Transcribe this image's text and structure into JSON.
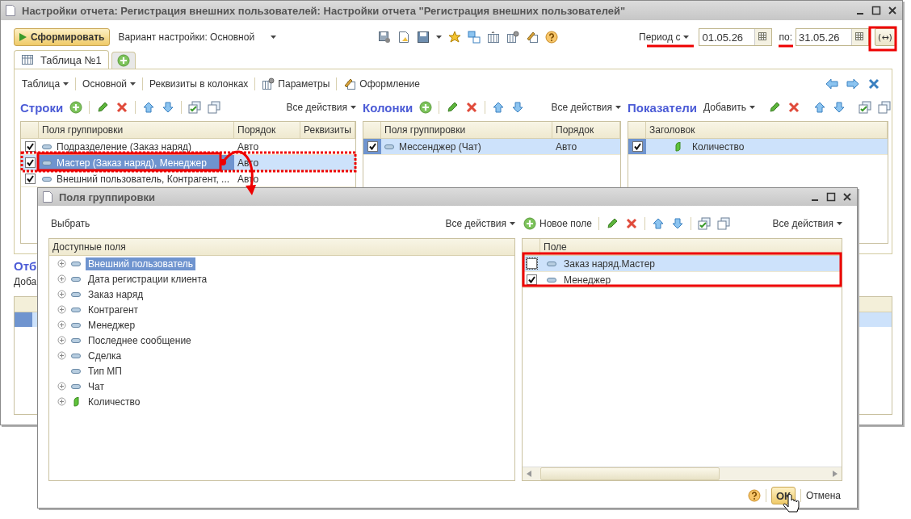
{
  "window": {
    "title": "Настройки отчета: Регистрация внешних пользователей: Настройки отчета \"Регистрация внешних пользователей\""
  },
  "toolbar": {
    "generate": "Сформировать",
    "variant": "Вариант настройки: Основной",
    "period_label": "Период с",
    "date_from": "01.05.26",
    "to_label": "по:",
    "date_to": "31.05.26",
    "period_button": "(↔)"
  },
  "tabs": [
    {
      "label": "Таблица №1",
      "selected": true
    }
  ],
  "settings_menu": [
    {
      "label": "Таблица",
      "kind": "menu"
    },
    {
      "label": "Основной",
      "kind": "menu"
    },
    {
      "label": "Реквизиты в колонках",
      "kind": "plain"
    },
    {
      "label": "Параметры",
      "kind": "params"
    },
    {
      "label": "Оформление",
      "kind": "design"
    }
  ],
  "rows_panel": {
    "title": "Строки",
    "all_actions": "Все действия",
    "columns": [
      "Поля группировки",
      "Порядок",
      "Реквизиты"
    ],
    "rows": [
      {
        "checked": true,
        "selected": false,
        "check_focused": false,
        "field_focused": false,
        "field": "Подразделение (Заказ наряд)",
        "order": "Авто"
      },
      {
        "checked": true,
        "selected": true,
        "check_focused": false,
        "field_focused": true,
        "field": "Мастер (Заказ наряд), Менеджер",
        "order": "Авто"
      },
      {
        "checked": true,
        "selected": false,
        "check_focused": false,
        "field_focused": false,
        "field": "Внешний пользователь, Контрагент, ...",
        "order": "Авто"
      }
    ]
  },
  "columns_panel": {
    "title": "Колонки",
    "all_actions": "Все действия",
    "columns": [
      "Поля группировки",
      "Порядок"
    ],
    "rows": [
      {
        "checked": true,
        "selected": true,
        "check_focused": true,
        "field_focused": false,
        "field": "Мессенджер (Чат)",
        "order": "Авто"
      }
    ]
  },
  "indicators_panel": {
    "title": "Показатели",
    "add": "Добавить",
    "columns": [
      "Заголовок"
    ],
    "rows": [
      {
        "checked": true,
        "selected": true,
        "check_focused": true,
        "field_focused": false,
        "field": "Количество"
      }
    ]
  },
  "filters_section": {
    "title": "Отб",
    "add": "Доба"
  },
  "dialog": {
    "title": "Поля группировки",
    "select": "Выбрать",
    "all_actions_left": "Все действия",
    "new_field": "Новое поле",
    "all_actions_right": "Все действия",
    "available": {
      "header": "Доступные поля",
      "items": [
        {
          "label": "Внешний пользователь",
          "kind": "field",
          "expandable": true,
          "selected": true
        },
        {
          "label": "Дата регистрации клиента",
          "kind": "field",
          "expandable": true,
          "selected": false
        },
        {
          "label": "Заказ наряд",
          "kind": "field",
          "expandable": true,
          "selected": false
        },
        {
          "label": "Контрагент",
          "kind": "field",
          "expandable": true,
          "selected": false
        },
        {
          "label": "Менеджер",
          "kind": "field",
          "expandable": true,
          "selected": false
        },
        {
          "label": "Последнее сообщение",
          "kind": "field",
          "expandable": true,
          "selected": false
        },
        {
          "label": "Сделка",
          "kind": "field",
          "expandable": true,
          "selected": false
        },
        {
          "label": "Тип МП",
          "kind": "field",
          "expandable": false,
          "selected": false
        },
        {
          "label": "Чат",
          "kind": "field",
          "expandable": true,
          "selected": false
        },
        {
          "label": "Количество",
          "kind": "resource",
          "expandable": true,
          "selected": false
        }
      ]
    },
    "chosen": {
      "header": "Поле",
      "rows": [
        {
          "label": "Заказ наряд.Мастер",
          "checked": false,
          "selected": true
        },
        {
          "label": "Менеджер",
          "checked": true,
          "selected": false
        }
      ]
    },
    "ok": "ОК",
    "cancel": "Отмена"
  }
}
